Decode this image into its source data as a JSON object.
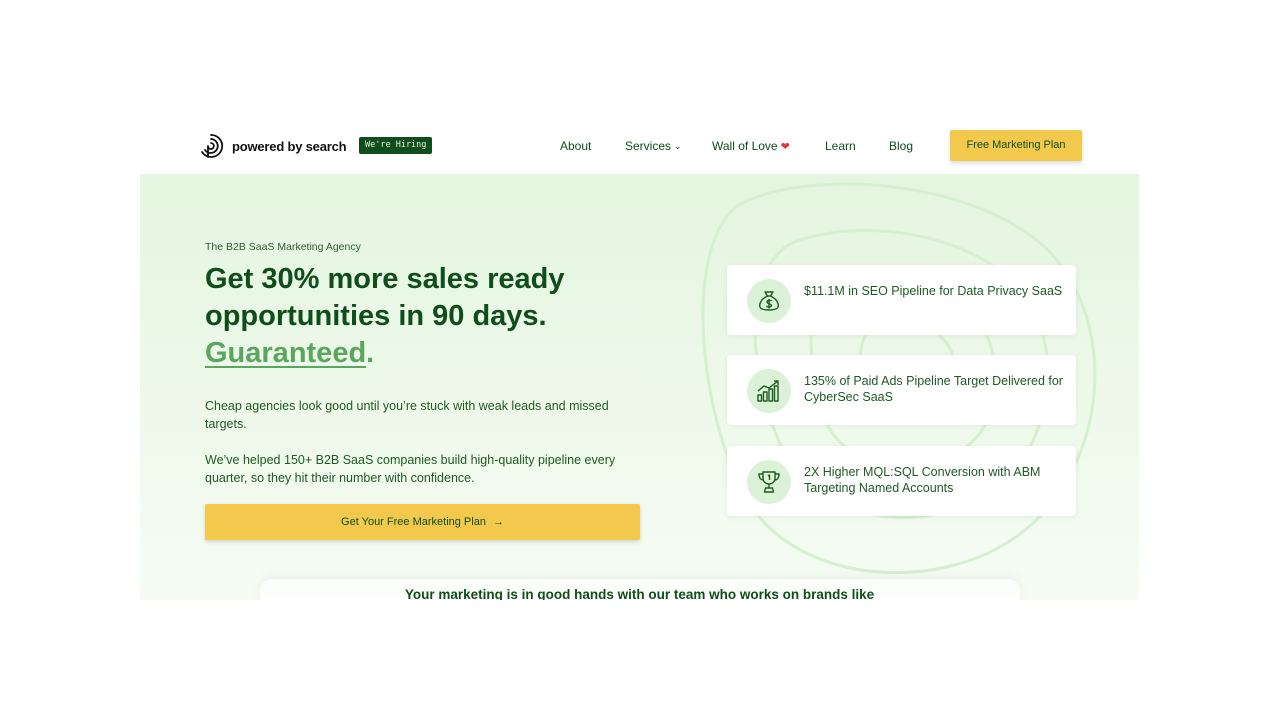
{
  "header": {
    "logo_text": "powered by search",
    "hiring_badge": "We're Hiring",
    "nav": [
      {
        "label": "About"
      },
      {
        "label": "Services"
      },
      {
        "label": "Wall of Love"
      },
      {
        "label": "Learn"
      },
      {
        "label": "Blog"
      }
    ],
    "cta_label": "Free Marketing Plan"
  },
  "hero": {
    "eyebrow": "The B2B SaaS Marketing Agency",
    "headline": "Get 30% more sales ready opportunities in 90 days.",
    "headline_emphasis": "Guaranteed",
    "headline_end": ".",
    "paragraph_1": "Cheap agencies look good until you’re stuck with weak leads and missed targets.",
    "paragraph_2": "We’ve helped 150+ B2B SaaS companies build high-quality pipeline every quarter, so they hit their number with confidence.",
    "cta_label": "Get Your Free Marketing Plan",
    "cta_arrow": "→"
  },
  "cards": [
    {
      "icon": "money-bag-icon",
      "text": "$11.1M in SEO Pipeline for Data Privacy SaaS"
    },
    {
      "icon": "growth-chart-icon",
      "text": "135% of Paid Ads Pipeline Target Delivered for CyberSec SaaS"
    },
    {
      "icon": "trophy-icon",
      "text": "2X Higher MQL:SQL Conversion with ABM Targeting Named Accounts"
    }
  ],
  "trust_heading": "Your marketing is in good hands with our team who works on brands like",
  "colors": {
    "brand_green": "#0f4d1a",
    "accent_green": "#5aa65e",
    "cta_yellow": "#f2c94c",
    "hero_bg": "#e4f5e0",
    "heart": "#e0343f"
  }
}
